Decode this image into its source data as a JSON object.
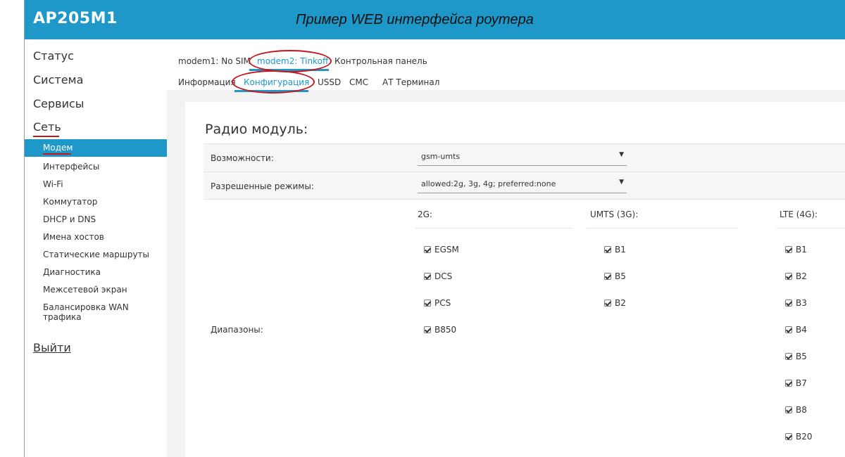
{
  "header": {
    "brand": "AP205M1",
    "caption": "Пример WEB интерфейса роутера"
  },
  "sidebar": {
    "top_items": [
      {
        "label": "Статус"
      },
      {
        "label": "Система"
      },
      {
        "label": "Сервисы"
      },
      {
        "label": "Сеть"
      }
    ],
    "sub_items": [
      {
        "label": "Модем"
      },
      {
        "label": "Интерфейсы"
      },
      {
        "label": "Wi-Fi"
      },
      {
        "label": "Коммутатор"
      },
      {
        "label": "DHCP и DNS"
      },
      {
        "label": "Имена хостов"
      },
      {
        "label": "Статические маршруты"
      },
      {
        "label": "Диагностика"
      },
      {
        "label": "Межсетевой экран"
      },
      {
        "label": "Балансировка WAN трафика"
      }
    ],
    "logout": "Выйти"
  },
  "tabs_primary": [
    {
      "label": "modem1: No SIM"
    },
    {
      "label": "modem2: Tinkoff"
    },
    {
      "label": "Контрольная панель"
    }
  ],
  "tabs_secondary": [
    {
      "label": "Информация"
    },
    {
      "label": "Конфигурация"
    },
    {
      "label": "USSD"
    },
    {
      "label": "СМС"
    },
    {
      "label": "АТ Терминал"
    }
  ],
  "panel": {
    "title": "Радио модуль:",
    "capabilities": {
      "label": "Возможности:",
      "value": "gsm-umts"
    },
    "modes": {
      "label": "Разрешенные режимы:",
      "value": "allowed:2g, 3g, 4g; preferred:none"
    },
    "bands": {
      "label": "Диапазоны:",
      "columns": [
        {
          "title": "2G:",
          "items": [
            "EGSM",
            "DCS",
            "PCS",
            "B850"
          ]
        },
        {
          "title": "UMTS (3G):",
          "items": [
            "B1",
            "B5",
            "B2"
          ]
        },
        {
          "title": "LTE (4G):",
          "items": [
            "B1",
            "B2",
            "B3",
            "B4",
            "B5",
            "B7",
            "B8",
            "B20"
          ]
        }
      ]
    }
  },
  "colors": {
    "accent": "#1e97c9",
    "annotation": "#c4161c"
  }
}
